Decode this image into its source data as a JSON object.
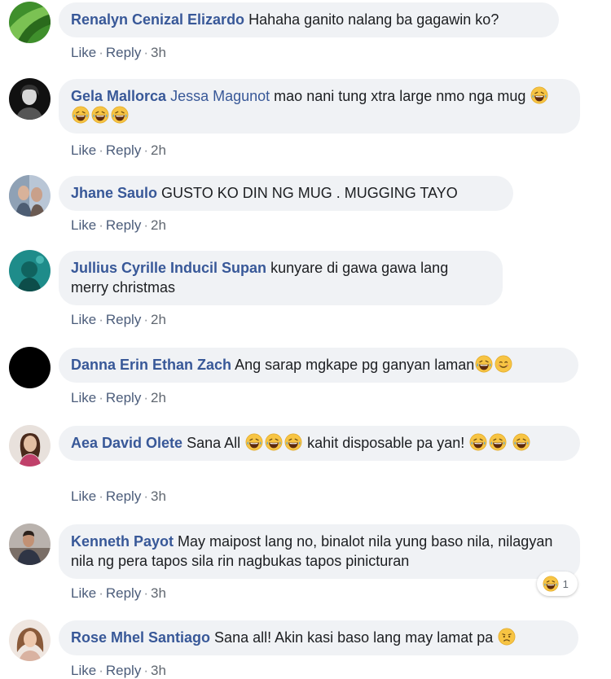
{
  "comments": [
    {
      "author": "Renalyn Cenizal Elizardo",
      "text": "Hahaha ganito nalang ba gagawin ko?",
      "like": "Like",
      "reply": "Reply",
      "time": "3h"
    },
    {
      "author": "Gela Mallorca",
      "mention": "Jessa Magunot",
      "text": "mao nani tung xtra large nmo nga mug",
      "like": "Like",
      "reply": "Reply",
      "time": "2h"
    },
    {
      "author": "Jhane Saulo",
      "text": "GUSTO KO DIN NG MUG . MUGGING TAYO",
      "like": "Like",
      "reply": "Reply",
      "time": "2h"
    },
    {
      "author": "Jullius Cyrille Inducil Supan",
      "text": "kunyare di gawa gawa lang merry christmas",
      "like": "Like",
      "reply": "Reply",
      "time": "2h"
    },
    {
      "author": "Danna Erin Ethan Zach",
      "text": "Ang sarap mgkape pg ganyan laman",
      "like": "Like",
      "reply": "Reply",
      "time": "2h"
    },
    {
      "author": "Aea David Olete",
      "text_a": "Sana All",
      "text_b": "kahit disposable pa yan!",
      "like": "Like",
      "reply": "Reply",
      "time": "3h"
    },
    {
      "author": "Kenneth Payot",
      "text": "May maipost lang no, binalot nila yung baso nila, nilagyan nila ng pera tapos sila rin nagbukas tapos pinicturan",
      "like": "Like",
      "reply": "Reply",
      "time": "3h",
      "reaction_count": "1"
    },
    {
      "author": "Rose Mhel Santiago",
      "text": "Sana all! Akin kasi baso lang may lamat pa",
      "like": "Like",
      "reply": "Reply",
      "time": "3h"
    }
  ],
  "separator": "·",
  "colors": {
    "author": "#385898",
    "bubble": "#f0f2f5",
    "action_text": "#606770",
    "emoji_yellow": "#f7c443"
  },
  "icons": {
    "laughing": "laughing-emoji-icon",
    "smiling": "smiling-emoji-icon",
    "worried": "worried-emoji-icon"
  }
}
